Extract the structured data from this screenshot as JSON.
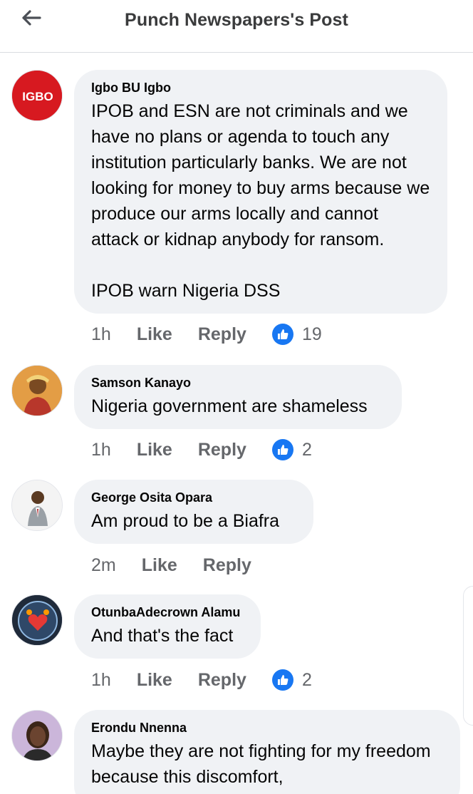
{
  "header": {
    "back_icon": "arrow-left-icon",
    "title": "Punch Newspapers's Post"
  },
  "comments": [
    {
      "author": "Igbo BU Igbo",
      "avatar_text": "IGBO",
      "avatar_color": "#d71920",
      "text": "IPOB and ESN are not criminals and we have no plans or agenda to touch any institution particularly banks. We are not looking for money to buy arms because we produce our arms locally and cannot attack or kidnap anybody for ransom.\n\nIPOB warn Nigeria DSS",
      "time": "1h",
      "like_label": "Like",
      "reply_label": "Reply",
      "reaction_count": "19"
    },
    {
      "author": "Samson Kanayo",
      "text": "Nigeria government are shameless",
      "time": "1h",
      "like_label": "Like",
      "reply_label": "Reply",
      "reaction_count": "2"
    },
    {
      "author": "George Osita Opara",
      "text": "Am proud to be a Biafra",
      "time": "2m",
      "like_label": "Like",
      "reply_label": "Reply"
    },
    {
      "author": "OtunbaAdecrown Alamu",
      "text": "And that's the fact",
      "time": "1h",
      "like_label": "Like",
      "reply_label": "Reply",
      "reaction_count": "2"
    },
    {
      "author": "Erondu Nnenna",
      "text": "Maybe they are not fighting for my freedom because this discomfort,"
    }
  ],
  "colors": {
    "like_blue": "#1877f2",
    "bubble_bg": "#f0f2f5",
    "meta_gray": "#65676b"
  }
}
